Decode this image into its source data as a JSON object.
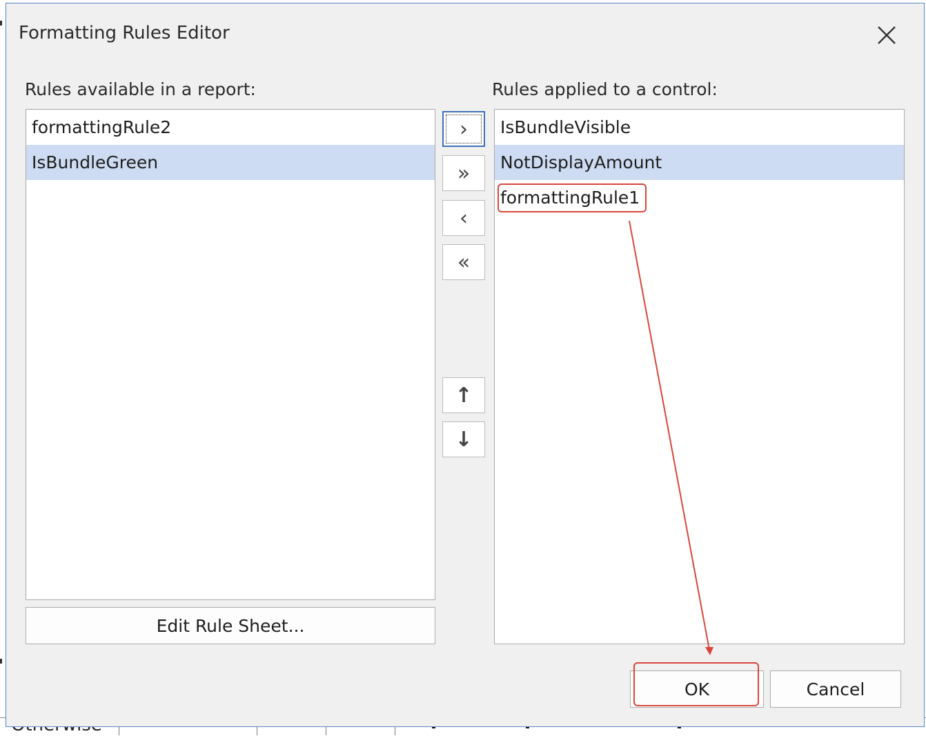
{
  "dialog": {
    "title": "Formatting Rules Editor"
  },
  "available": {
    "label": "Rules available in a report:",
    "items": [
      "formattingRule2",
      "IsBundleGreen"
    ],
    "selected_index": 1,
    "edit_button_label": "Edit Rule Sheet..."
  },
  "applied": {
    "label": "Rules applied to a control:",
    "items": [
      "IsBundleVisible",
      "NotDisplayAmount",
      "formattingRule1"
    ],
    "selected_index": 1,
    "highlighted_index": 2
  },
  "transfer_buttons": {
    "add": "›",
    "add_all": "»",
    "remove": "‹",
    "remove_all": "«",
    "move_up": "↑",
    "move_down": "↓"
  },
  "footer": {
    "ok_label": "OK",
    "cancel_label": "Cancel"
  },
  "background": {
    "partial_text": "Otherwise"
  },
  "colors": {
    "accent_border": "#5a86c6",
    "selection": "#cddcf2",
    "annotation": "#d9453a"
  }
}
